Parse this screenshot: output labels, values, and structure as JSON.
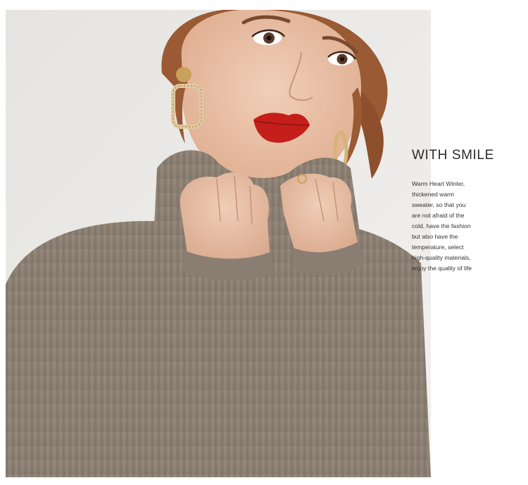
{
  "photo": {
    "subject": "woman in turtleneck sweater",
    "colors": {
      "background": "#eceae7",
      "sweater": "#8f8376",
      "skin": "#e9c2a8",
      "hair": "#9a5a34",
      "lips": "#c41f1a",
      "earring": "#c9a15a"
    }
  },
  "copy": {
    "headline": "WITH SMILE",
    "lines": [
      "Warm Heart Winter,",
      "thickened warm",
      "sweater, so that you",
      "are not afraid of the",
      "cold, have the fashion",
      "but also have the",
      "temperature, select",
      "high-quality materials,",
      "enjoy the quality of life"
    ]
  }
}
